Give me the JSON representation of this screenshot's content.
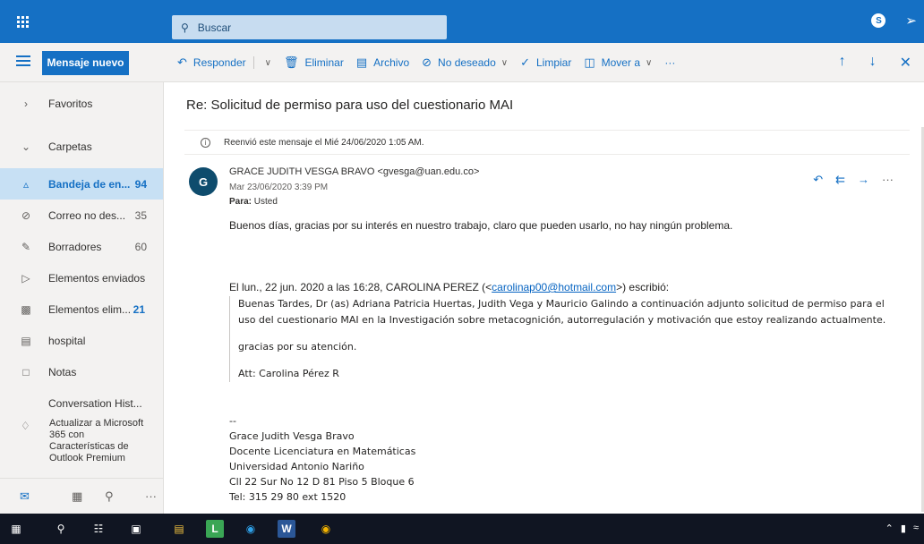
{
  "topbar": {
    "search_placeholder": "Buscar",
    "skype_letter": "S"
  },
  "commandbar": {
    "new_message": "Mensaje nuevo",
    "reply": "Responder",
    "delete": "Eliminar",
    "archive": "Archivo",
    "junk": "No deseado",
    "sweep": "Limpiar",
    "move_to": "Mover a",
    "more": "···"
  },
  "sidebar": {
    "favorites": "Favoritos",
    "folders": "Carpetas",
    "items": [
      {
        "label": "Bandeja de en...",
        "count": "94"
      },
      {
        "label": "Correo no des...",
        "count": "35"
      },
      {
        "label": "Borradores",
        "count": "60"
      },
      {
        "label": "Elementos enviados",
        "count": ""
      },
      {
        "label": "Elementos elim...",
        "count": "21"
      },
      {
        "label": "hospital",
        "count": ""
      },
      {
        "label": "Notas",
        "count": ""
      },
      {
        "label": "Conversation Hist...",
        "count": ""
      }
    ],
    "upgrade": "Actualizar a Microsoft 365 con Características de Outlook Premium"
  },
  "message": {
    "subject": "Re: Solicitud de permiso para uso del cuestionario MAI",
    "forward_info": "Reenvió este mensaje el Mié 24/06/2020 1:05 AM.",
    "avatar_initial": "G",
    "sender": "GRACE JUDITH VESGA BRAVO <gvesga@uan.edu.co>",
    "date": "Mar 23/06/2020 3:39 PM",
    "to_label": "Para:",
    "to_value": "Usted",
    "body": "Buenos días, gracias por su interés en nuestro trabajo, claro que pueden usarlo, no hay ningún problema.",
    "quote_prefix": "El lun., 22 jun. 2020 a las 16:28, CAROLINA PEREZ (<",
    "quote_email": "carolinap00@hotmail.com",
    "quote_suffix": ">) escribió:",
    "quote_line1": "Buenas Tardes, Dr (as) Adriana Patricia Huertas, Judith Vega y Mauricio Galindo a continuación adjunto solicitud de permiso para el",
    "quote_line2": "uso del cuestionario MAI en la Investigación sobre metacognición, autorregulación y motivación que estoy realizando actualmente.",
    "quote_thanks": "gracias por su atención.",
    "quote_att": "Att: Carolina Pérez R",
    "sig_dash": "--",
    "sig_name": "Grace Judith Vesga Bravo",
    "sig_title": "Docente Licenciatura en Matemáticas",
    "sig_univ": "Universidad Antonio Nariño",
    "sig_addr": "Cll 22 Sur No 12 D 81 Piso 5 Bloque 6",
    "sig_tel": "Tel: 315 29 80 ext 1520"
  },
  "taskbar": {
    "word_label": "W",
    "ide_label": "L"
  },
  "colors": {
    "brand": "#1570c4",
    "sidebar_bg": "#f3f2f1",
    "selected_bg": "#c7e0f4",
    "avatar": "#0e4c6d"
  }
}
